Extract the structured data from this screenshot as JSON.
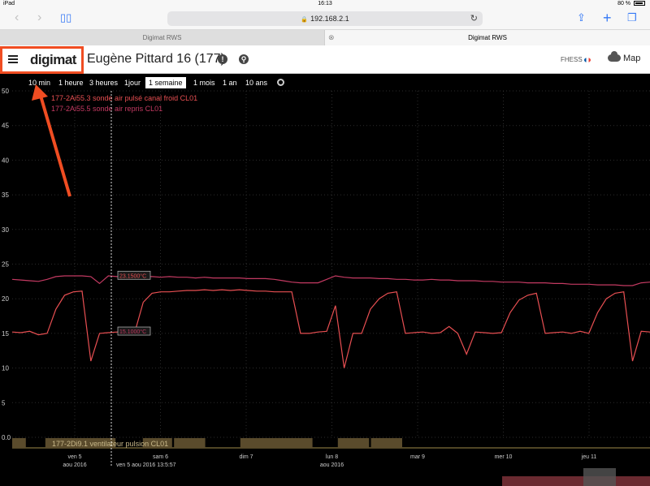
{
  "status": {
    "device": "iPad",
    "time": "16:13",
    "battery": "80 %"
  },
  "browser": {
    "url": "192.168.2.1"
  },
  "tabs": [
    {
      "title": "Digimat RWS"
    },
    {
      "title": "Digimat RWS"
    }
  ],
  "app": {
    "logo": "digimat",
    "title": "Eugène Pittard 16 (177)",
    "user": "FHESS",
    "map_label": "Map"
  },
  "ranges": [
    "10 min",
    "1 heure",
    "3 heures",
    "1jour",
    "1 semaine",
    "1 mois",
    "1 an",
    "10 ans"
  ],
  "active_range": "1 semaine",
  "colors": {
    "series1": "#e84f52",
    "series2": "#c43a62",
    "digital": "#5a4b2c",
    "highlight": "#f04d22"
  },
  "chart_data": {
    "type": "line",
    "ylim": [
      0,
      50
    ],
    "y_ticks": [
      "0.0",
      "5",
      "10",
      "15",
      "20",
      "25",
      "30",
      "35",
      "40",
      "45",
      "50"
    ],
    "x_ticks": [
      {
        "label": "ven 5",
        "sub": "aou 2016"
      },
      {
        "label": "sam 6",
        "sub": ""
      },
      {
        "label": "dim 7",
        "sub": ""
      },
      {
        "label": "lun 8",
        "sub": "aou 2016"
      },
      {
        "label": "mar 9",
        "sub": ""
      },
      {
        "label": "mer 10",
        "sub": ""
      },
      {
        "label": "jeu 11",
        "sub": ""
      }
    ],
    "cursor": {
      "label": "ven 5 aou 2016 13:5:57",
      "values": [
        "23.1500°C",
        "15.1000°C"
      ]
    },
    "series": [
      {
        "name": "177-2Ai55.3 sonde air pulsé canal froid CL01",
        "values": [
          15.2,
          15.1,
          15.3,
          14.8,
          15.0,
          18.5,
          20.5,
          21.0,
          21.1,
          11.0,
          15.0,
          15.1,
          15.2,
          15.1,
          15.0,
          19.5,
          20.8,
          21.0,
          21.0,
          21.1,
          21.2,
          21.2,
          21.3,
          21.2,
          21.3,
          21.2,
          21.3,
          21.2,
          21.1,
          21.1,
          21.0,
          21.0,
          21.0,
          15.0,
          15.0,
          15.2,
          15.3,
          19.0,
          10.0,
          15.0,
          15.0,
          18.5,
          20.0,
          20.8,
          21.0,
          15.0,
          15.1,
          15.2,
          15.0,
          15.1,
          16.0,
          15.0,
          12.0,
          15.2,
          15.1,
          15.0,
          15.1,
          18.0,
          19.8,
          20.5,
          20.8,
          15.0,
          15.1,
          15.2,
          15.0,
          15.3,
          15.0,
          18.0,
          20.0,
          20.8,
          21.0,
          11.0,
          15.3,
          15.2
        ]
      },
      {
        "name": "177-2Ai55.5 sonde air repris CL01",
        "values": [
          22.8,
          22.7,
          22.6,
          22.5,
          22.8,
          23.2,
          23.3,
          23.3,
          23.3,
          23.2,
          22.2,
          23.3,
          23.2,
          23.2,
          23.1,
          23.2,
          23.2,
          23.1,
          23.2,
          23.1,
          23.1,
          23.0,
          23.1,
          23.0,
          23.0,
          23.0,
          23.0,
          22.9,
          22.9,
          22.9,
          22.8,
          22.6,
          22.4,
          22.3,
          22.3,
          22.3,
          22.8,
          23.3,
          23.1,
          23.0,
          23.0,
          23.0,
          22.9,
          22.9,
          22.8,
          22.8,
          22.7,
          22.7,
          22.8,
          22.7,
          22.7,
          22.6,
          22.6,
          22.6,
          22.5,
          22.5,
          22.4,
          22.4,
          22.4,
          22.3,
          22.3,
          22.3,
          22.2,
          22.2,
          22.1,
          22.1,
          22.1,
          22.0,
          22.0,
          22.0,
          21.9,
          21.9,
          22.3,
          22.4
        ]
      }
    ],
    "digital_series": {
      "name": "177-2Di9.1 ventilateur pulsion CL01",
      "on_intervals": [
        [
          0,
          0.07
        ],
        [
          0.17,
          0.53
        ],
        [
          0.67,
          0.82
        ],
        [
          0.83,
          0.99
        ],
        [
          1.17,
          1.54
        ],
        [
          1.67,
          1.83
        ],
        [
          1.84,
          2.0
        ]
      ]
    }
  }
}
